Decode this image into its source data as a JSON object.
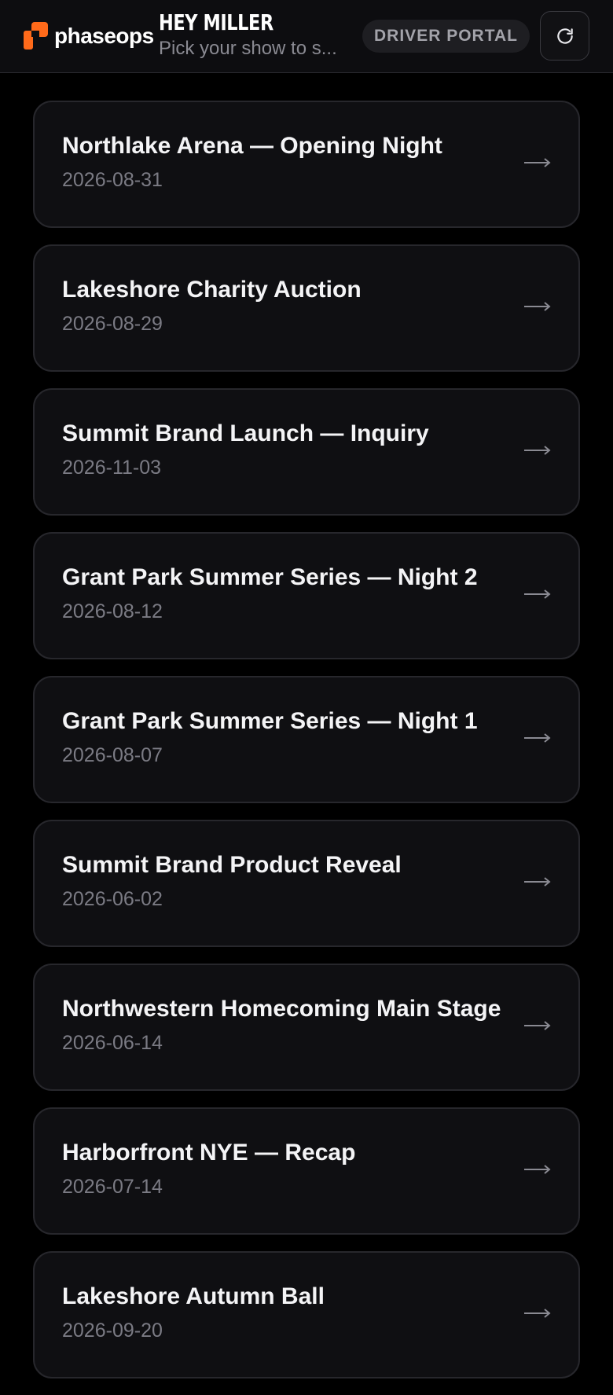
{
  "brand": {
    "name": "phaseops",
    "accent": "#ff6a1a"
  },
  "header": {
    "title": "HEY MILLER",
    "subtitle": "Pick your show to s...",
    "portal_badge": "DRIVER PORTAL",
    "refresh_icon": "refresh-icon"
  },
  "shows": [
    {
      "title": "Northlake Arena — Opening Night",
      "date": "2026-08-31"
    },
    {
      "title": "Lakeshore Charity Auction",
      "date": "2026-08-29"
    },
    {
      "title": "Summit Brand Launch — Inquiry",
      "date": "2026-11-03"
    },
    {
      "title": "Grant Park Summer Series — Night 2",
      "date": "2026-08-12"
    },
    {
      "title": "Grant Park Summer Series — Night 1",
      "date": "2026-08-07"
    },
    {
      "title": "Summit Brand Product Reveal",
      "date": "2026-06-02"
    },
    {
      "title": "Northwestern Homecoming Main Stage",
      "date": "2026-06-14"
    },
    {
      "title": "Harborfront NYE — Recap",
      "date": "2026-07-14"
    },
    {
      "title": "Lakeshore Autumn Ball",
      "date": "2026-09-20"
    }
  ],
  "colors": {
    "background": "#000000",
    "card": "#0f0f12",
    "card_border": "#27272c",
    "muted_text": "#7b7b84"
  }
}
